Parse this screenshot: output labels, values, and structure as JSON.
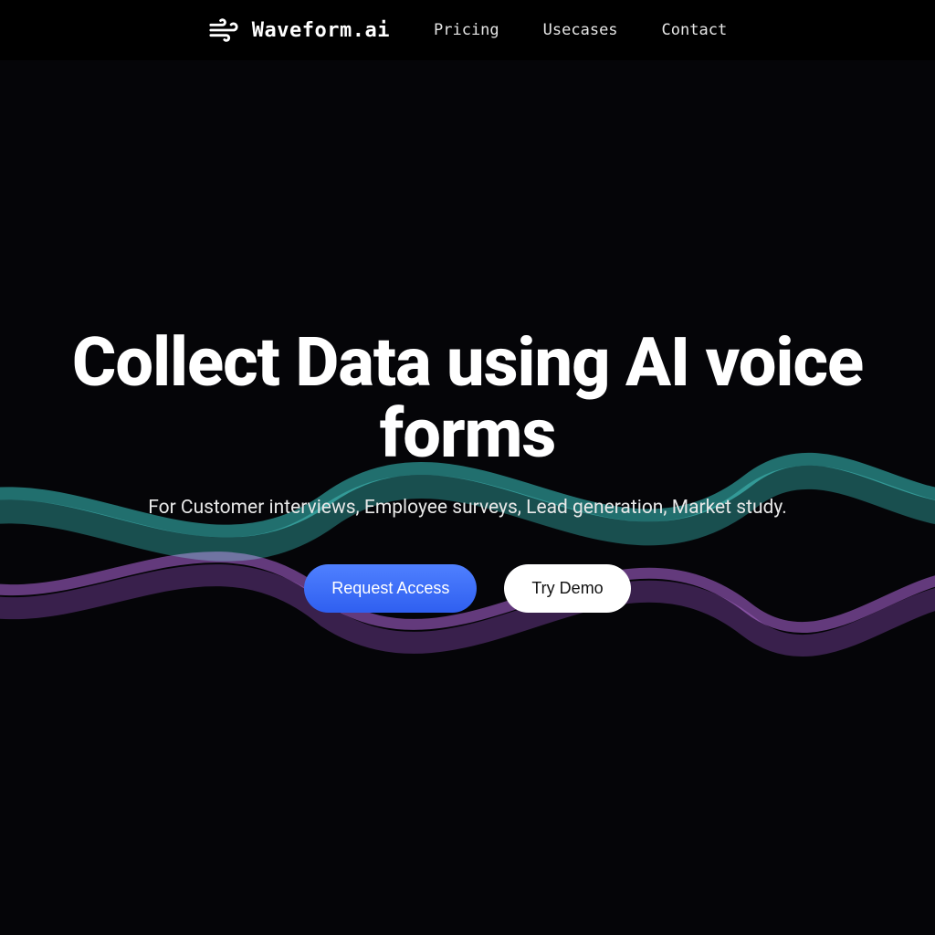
{
  "nav": {
    "brand": "Waveform.ai",
    "links": [
      {
        "label": "Pricing"
      },
      {
        "label": "Usecases"
      },
      {
        "label": "Contact"
      }
    ]
  },
  "hero": {
    "headline": "Collect Data using AI voice forms",
    "subhead": "For Customer interviews, Employee surveys, Lead generation, Market study.",
    "primary_cta": "Request Access",
    "secondary_cta": "Try Demo"
  },
  "colors": {
    "accent": "#2f5ff0",
    "wave_a": "#38d6d0",
    "wave_b": "#b05be6"
  }
}
